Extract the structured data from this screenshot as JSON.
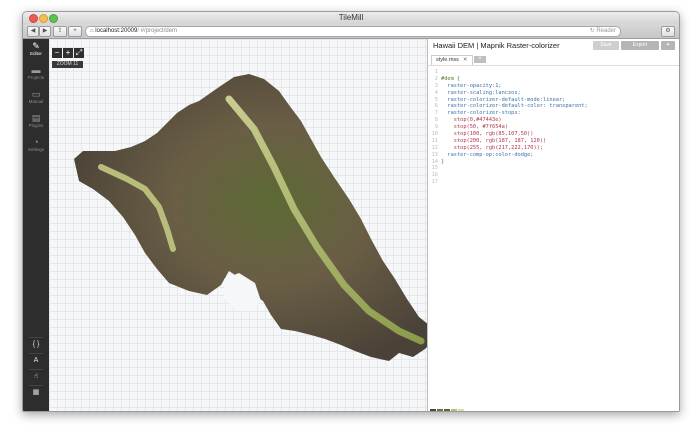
{
  "window": {
    "title": "TileMill"
  },
  "browser": {
    "back_icon": "back-arrow-icon",
    "forward_icon": "forward-arrow-icon",
    "share_icon": "share-icon",
    "url_host": "localhost:20009",
    "url_path": "/ #/project/dem",
    "reader_label": "Reader"
  },
  "sidebar": {
    "items": [
      {
        "label": "Editor",
        "icon": "pencil-icon"
      },
      {
        "label": "Projects",
        "icon": "folder-icon"
      },
      {
        "label": "Manual",
        "icon": "book-icon"
      },
      {
        "label": "Plugins",
        "icon": "plugin-icon"
      },
      {
        "label": "Settings",
        "icon": "settings-icon"
      }
    ],
    "tools": [
      {
        "label": "{ }",
        "icon": "code-braces-icon"
      },
      {
        "label": "A",
        "icon": "font-icon"
      },
      {
        "label": "☝",
        "icon": "hand-icon"
      },
      {
        "label": "▦",
        "icon": "layers-icon"
      }
    ]
  },
  "map": {
    "zoom_out": "−",
    "zoom_in": "+",
    "fullscreen": "⤢",
    "zoom_label": "ZOOM 11"
  },
  "editor": {
    "title": "Hawaii DEM | Mapnik Raster-colorizer",
    "save_label": "Save",
    "export_label": "Export",
    "tab_label": "style.mss",
    "tab_close": "✕",
    "add_tab": "+",
    "code_lines": [
      "",
      "#dem {",
      "  raster-opacity:1;",
      "  raster-scaling:lanczos;",
      "  raster-colorizer-default-mode:linear;",
      "  raster-colorizer-default-color: transparent;",
      "  raster-colorizer-stops:",
      "    stop(0,#47443e)",
      "    stop(50, #7f654a)",
      "    stop(100, rgb(85,107,50))",
      "    stop(200, rgb(187, 187, 120))",
      "    stop(255, rgb(217,222,170));",
      "  raster-comp-op:color-dodge;",
      "}",
      "",
      "",
      ""
    ]
  },
  "palette": [
    "#47443e",
    "#7f654a",
    "#556b32",
    "#bbbb78",
    "#d9deaa"
  ]
}
